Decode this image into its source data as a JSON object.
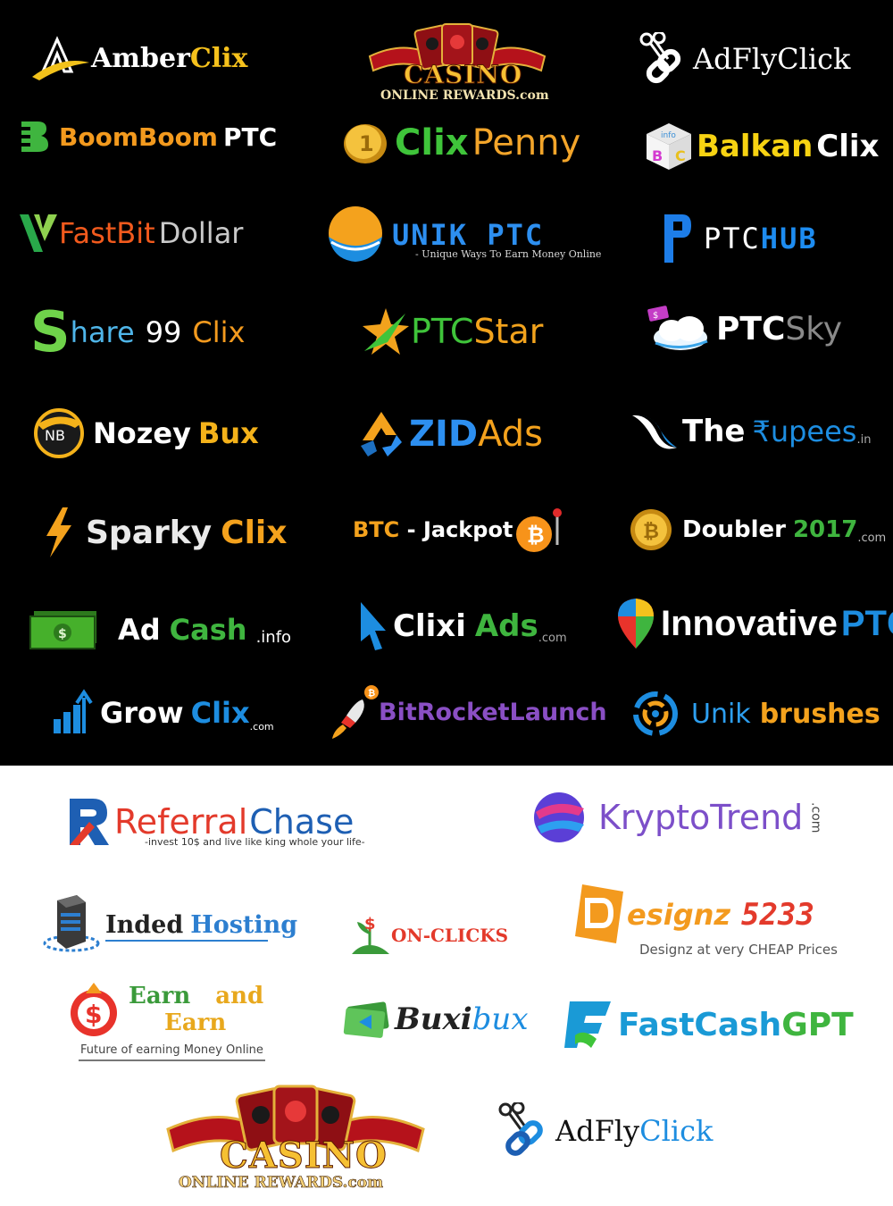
{
  "logos_dark": {
    "amberclix": {
      "a": "Amber",
      "b": "Clix"
    },
    "casino_top": {
      "title": "CASINO",
      "sub": "ONLINE REWARDS.com"
    },
    "adflyclick_top": {
      "a": "AdFly",
      "b": "Click"
    },
    "boomboom": {
      "a": "BoomBoom",
      "b": "PTC"
    },
    "clixpenny": {
      "a": "Clix",
      "b": "Penny"
    },
    "balkanclix": {
      "a": "Balkan",
      "b": "Clix",
      "cube": [
        "info",
        "B",
        "C"
      ]
    },
    "fastbit": {
      "a": "FastBit",
      "b": "Dollar"
    },
    "unikptc": {
      "a": "UNIK PTC",
      "tagline": "- Unique Ways To Earn Money Online"
    },
    "ptchub": {
      "a": "PTC",
      "b": "HUB"
    },
    "share99": {
      "s": "S",
      "a": "hare",
      "b": "99",
      "c": "Clix"
    },
    "ptcstar": {
      "a": "PTC",
      "b": "Star"
    },
    "ptcsky": {
      "a": "PTC",
      "b": "Sky"
    },
    "nozeybux": {
      "badge": "NB",
      "a": "Nozey",
      "b": "Bux"
    },
    "zidads": {
      "a": "ZID",
      "b": "Ads"
    },
    "therupees": {
      "a": "The",
      "b": "₹upees",
      "c": ".in"
    },
    "sparkyclix": {
      "a": "Sparky",
      "b": "Clix"
    },
    "btcjackpot": {
      "a": "BTC",
      "b": " - ",
      "c": "Jackpot"
    },
    "doubler": {
      "a": "Doubler",
      "b": "2017",
      "c": ".com"
    },
    "adcash": {
      "a": "Ad",
      "b": "Cash",
      "c": ".info"
    },
    "clixiads": {
      "a": "Clixi",
      "b": "Ads",
      "c": ".com"
    },
    "innovativeptc": {
      "a": "Innovative",
      "b": "PTC"
    },
    "growclix": {
      "a": "Grow",
      "b": "Clix",
      "c": ".com"
    },
    "bitrocket": {
      "a": "BitRocketLaunch"
    },
    "unikbrushes": {
      "a": "Unik",
      "b": "brushes"
    }
  },
  "logos_light": {
    "referralchase": {
      "a": "Referral",
      "b": "Chase",
      "tagline": "-invest 10$ and live like king whole your life-"
    },
    "kryptotrend": {
      "a": "KryptoTrend",
      "b": ".com"
    },
    "inded": {
      "a": "Inded",
      "b": "Hosting"
    },
    "onclicks": {
      "a": "ON-CLICKS"
    },
    "designz": {
      "a": "esignz",
      "b": "5233",
      "tagline": "Designz at very CHEAP Prices"
    },
    "earnandearn": {
      "a": "Earn",
      "b": "and",
      "c": "Earn",
      "tagline": "Future of earning Money Online"
    },
    "buxibux": {
      "a": "Buxi",
      "b": "bux"
    },
    "fastcashgpt": {
      "a": "FastCash",
      "b": "GPT"
    },
    "casino_bottom": {
      "title": "CASINO",
      "sub": "ONLINE REWARDS.com"
    },
    "adflyclick_bottom": {
      "a": "AdFly",
      "b": "Click"
    }
  },
  "colors": {
    "background_top": "#000000",
    "background_bottom": "#ffffff",
    "gold": "#f5c23a",
    "orange": "#f39a1e"
  }
}
